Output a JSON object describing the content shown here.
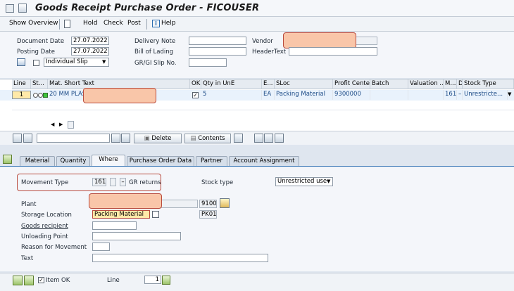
{
  "window": {
    "title": "Goods Receipt Purchase Order - FICOUSER"
  },
  "toolbar": {
    "show_overview": "Show Overview",
    "hold": "Hold",
    "check": "Check",
    "post": "Post",
    "help": "Help",
    "help_icon_text": "i"
  },
  "header": {
    "document_date_label": "Document Date",
    "document_date": "27.07.2022",
    "posting_date_label": "Posting Date",
    "posting_date": "27.07.2022",
    "delivery_note_label": "Delivery Note",
    "bill_of_lading_label": "Bill of Lading",
    "gr_gi_slip_label": "GR/GI Slip No.",
    "vendor_label": "Vendor",
    "header_text_label": "HeaderText",
    "slip_option": "Individual Slip"
  },
  "grid": {
    "columns": [
      "Line",
      "St...",
      "Mat. Short Text",
      "OK",
      "Qty in UnE",
      "E...",
      "SLoc",
      "Profit Center",
      "Batch",
      "Valuation ...",
      "M...",
      "D",
      "Stock Type"
    ],
    "rows": [
      {
        "line": "1",
        "material": "20 MM PLAS",
        "ok": "✓",
        "qty": "5",
        "unit": "EA",
        "sloc": "Packing Material",
        "profit_center": "9300000",
        "batch": "",
        "valuation": "",
        "movement": "161",
        "d": "–",
        "stock_type": "Unrestricte..."
      }
    ]
  },
  "buttons": {
    "delete": "Delete",
    "contents": "Contents"
  },
  "tabs": [
    "Material",
    "Quantity",
    "Where",
    "Purchase Order Data",
    "Partner",
    "Account Assignment"
  ],
  "where": {
    "movement_type_label": "Movement Type",
    "movement_type": "161",
    "movement_indicator": "",
    "movement_sign": "–",
    "movement_text": "GR returns",
    "stock_type_label": "Stock type",
    "stock_type": "Unrestricted use",
    "plant_label": "Plant",
    "plant_code": "9100",
    "storage_location_label": "Storage Location",
    "storage_location": "Packing Material",
    "storage_location_code": "PK01",
    "goods_recipient_label": "Goods recipient",
    "unloading_point_label": "Unloading Point",
    "reason_label": "Reason for Movement",
    "text_label": "Text"
  },
  "footer": {
    "item_ok_label": "Item OK",
    "item_ok": "✓",
    "line_label": "Line",
    "line_value": "1"
  },
  "colors": {
    "accent": "#2c6eb1",
    "highlight_box": "#b94b3e",
    "redaction": "#f9c6a9"
  }
}
